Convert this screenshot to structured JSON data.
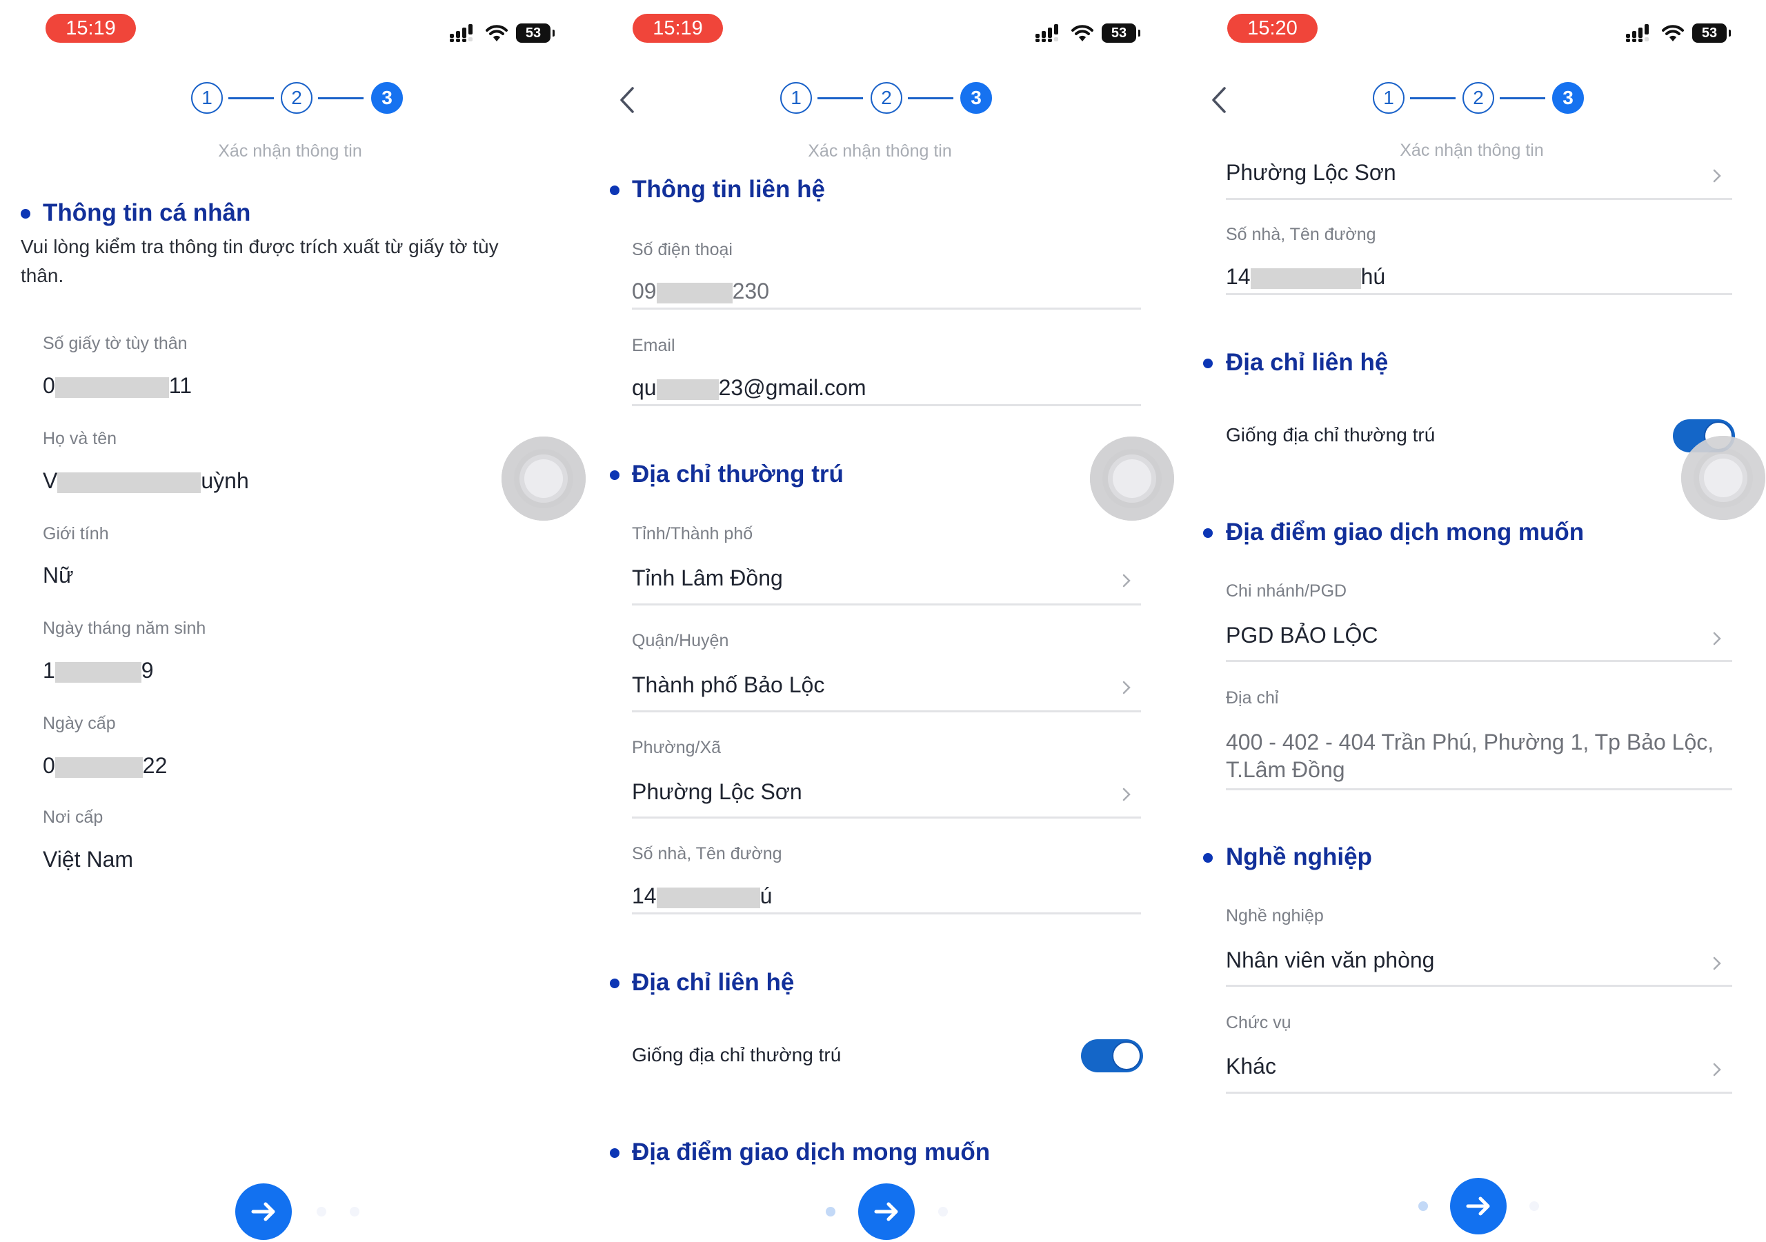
{
  "brand": {
    "primary": "#1271f0",
    "heading": "#12309a",
    "time_pill": "#f0453a"
  },
  "panels": [
    {
      "status": {
        "time": "15:19",
        "battery": "53",
        "signal_icon": "cellular-signal-icon",
        "wifi_icon": "wifi-icon"
      },
      "has_back": false,
      "steps": [
        "1",
        "2",
        "3"
      ],
      "active_step": 3,
      "step_label": "Xác nhận thông tin",
      "section_title": "Thông tin cá nhân",
      "description": "Vui lòng kiểm tra thông tin được trích xuất từ giấy tờ tùy thân.",
      "fields": [
        {
          "label": "Số giấy tờ tùy thân",
          "value_prefix": "0",
          "value_suffix": "11",
          "redacted": true
        },
        {
          "label": "Họ và tên",
          "value_prefix": "V",
          "value_suffix": "uỳnh",
          "redacted": true
        },
        {
          "label": "Giới tính",
          "value": "Nữ"
        },
        {
          "label": "Ngày tháng năm sinh",
          "value_prefix": "1",
          "value_suffix": "9",
          "redacted": true
        },
        {
          "label": "Ngày cấp",
          "value_prefix": "0",
          "value_suffix": "22",
          "redacted": true
        },
        {
          "label": "Nơi cấp",
          "value": "Việt Nam"
        }
      ],
      "pagination": {
        "current": 1,
        "total": 3
      }
    },
    {
      "status": {
        "time": "15:19",
        "battery": "53"
      },
      "has_back": true,
      "steps": [
        "1",
        "2",
        "3"
      ],
      "active_step": 3,
      "step_label": "Xác nhận thông tin",
      "contact": {
        "title": "Thông tin liên hệ",
        "phone_label": "Số điện thoại",
        "phone_prefix": "09",
        "phone_suffix": "230",
        "email_label": "Email",
        "email_prefix": "qu",
        "email_suffix": "23@gmail.com"
      },
      "permanent": {
        "title": "Địa chỉ thường trú",
        "province_label": "Tỉnh/Thành phố",
        "province": "Tỉnh Lâm Đồng",
        "district_label": "Quận/Huyện",
        "district": "Thành phố Bảo Lộc",
        "ward_label": "Phường/Xã",
        "ward": "Phường Lộc Sơn",
        "street_label": "Số nhà, Tên đường",
        "street_prefix": "14",
        "street_suffix": "ú"
      },
      "contact_address": {
        "title": "Địa chỉ liên hệ",
        "same_label": "Giống địa chỉ thường trú",
        "same_on": true
      },
      "preferred": {
        "title": "Địa điểm giao dịch mong muốn"
      },
      "pagination": {
        "current": 2,
        "total": 3
      }
    },
    {
      "status": {
        "time": "15:20",
        "battery": "53"
      },
      "has_back": true,
      "steps": [
        "1",
        "2",
        "3"
      ],
      "active_step": 3,
      "step_label": "Xác nhận thông tin",
      "ward": "Phường Lộc Sơn",
      "street_label": "Số nhà, Tên đường",
      "street_prefix": "14",
      "street_suffix": "hú",
      "contact_address": {
        "title": "Địa chỉ liên hệ",
        "same_label": "Giống địa chỉ thường trú",
        "same_on": true
      },
      "preferred": {
        "title": "Địa điểm giao dịch mong muốn",
        "branch_label": "Chi nhánh/PGD",
        "branch": "PGD BẢO LỘC",
        "address_label": "Địa chỉ",
        "address": "400 - 402 - 404 Trần Phú, Phường 1, Tp Bảo Lộc, T.Lâm Đồng"
      },
      "job": {
        "title": "Nghề nghiệp",
        "occupation_label": "Nghề nghiệp",
        "occupation": "Nhân viên văn phòng",
        "position_label": "Chức vụ",
        "position": "Khác"
      },
      "pagination": {
        "current": 2,
        "total": 3
      }
    }
  ]
}
